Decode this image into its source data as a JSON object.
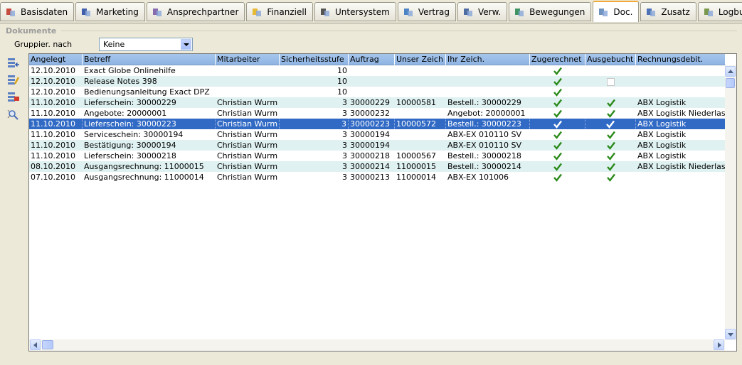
{
  "tabs": [
    {
      "label": "Basisdaten",
      "icon": "basisdaten-icon"
    },
    {
      "label": "Marketing",
      "icon": "marketing-icon"
    },
    {
      "label": "Ansprechpartner",
      "icon": "ansprechpartner-icon"
    },
    {
      "label": "Finanziell",
      "icon": "finanziell-icon"
    },
    {
      "label": "Untersystem",
      "icon": "untersystem-icon"
    },
    {
      "label": "Vertrag",
      "icon": "vertrag-icon"
    },
    {
      "label": "Verw.",
      "icon": "verw-icon"
    },
    {
      "label": "Bewegungen",
      "icon": "bewegungen-icon"
    },
    {
      "label": "Doc.",
      "icon": "doc-icon",
      "active": true
    },
    {
      "label": "Zusatz",
      "icon": "zusatz-icon"
    },
    {
      "label": "Logbuch",
      "icon": "logbuch-icon"
    }
  ],
  "group": {
    "title": "Dokumente",
    "grouping_label": "Gruppier. nach",
    "grouping_value": "Keine"
  },
  "side_icons": [
    "new-document-icon",
    "edit-document-icon",
    "delete-document-icon",
    "attach-search-icon"
  ],
  "table": {
    "columns": [
      "Angelegt",
      "Betreff",
      "Mitarbeiter",
      "Sicherheitsstufe",
      "Auftrag",
      "Unser Zeich",
      "Ihr Zeich.",
      "Zugerechnet",
      "Ausgebucht",
      "Rechnungsdebit."
    ],
    "rows": [
      {
        "angelegt": "12.10.2010",
        "betreff": "Exact Globe Onlinehilfe",
        "mitarbeiter": "",
        "stufe": "10",
        "auftrag": "",
        "unser": "",
        "ihr": "",
        "zug": "check",
        "aus": "",
        "rech": ""
      },
      {
        "angelegt": "12.10.2010",
        "betreff": "Release Notes 398",
        "mitarbeiter": "",
        "stufe": "10",
        "auftrag": "",
        "unser": "",
        "ihr": "",
        "zug": "check",
        "aus": "box",
        "rech": ""
      },
      {
        "angelegt": "12.10.2010",
        "betreff": "Bedienungsanleitung Exact DPZ",
        "mitarbeiter": "",
        "stufe": "10",
        "auftrag": "",
        "unser": "",
        "ihr": "",
        "zug": "check",
        "aus": "",
        "rech": ""
      },
      {
        "angelegt": "11.10.2010",
        "betreff": "Lieferschein: 30000229",
        "mitarbeiter": "Christian Wurm",
        "stufe": "3",
        "auftrag": "30000229",
        "unser": "10000581",
        "ihr": "Bestell.: 30000229",
        "zug": "check",
        "aus": "check",
        "rech": "ABX Logistik"
      },
      {
        "angelegt": "11.10.2010",
        "betreff": "Angebote: 20000001",
        "mitarbeiter": "Christian Wurm",
        "stufe": "3",
        "auftrag": "30000232",
        "unser": "",
        "ihr": "Angebot: 20000001",
        "zug": "check",
        "aus": "check",
        "rech": "ABX Logistik Niederlas"
      },
      {
        "angelegt": "11.10.2010",
        "betreff": "Lieferschein: 30000223",
        "mitarbeiter": "Christian Wurm",
        "stufe": "3",
        "auftrag": "30000223",
        "unser": "10000572",
        "ihr": "Bestell.: 30000223",
        "zug": "check",
        "aus": "check",
        "rech": "ABX Logistik",
        "selected": true
      },
      {
        "angelegt": "11.10.2010",
        "betreff": "Serviceschein: 30000194",
        "mitarbeiter": "Christian Wurm",
        "stufe": "3",
        "auftrag": "30000194",
        "unser": "",
        "ihr": "ABX-EX 010110 SV",
        "zug": "check",
        "aus": "check",
        "rech": "ABX Logistik"
      },
      {
        "angelegt": "11.10.2010",
        "betreff": "Bestätigung: 30000194",
        "mitarbeiter": "Christian Wurm",
        "stufe": "3",
        "auftrag": "30000194",
        "unser": "",
        "ihr": "ABX-EX 010110 SV",
        "zug": "check",
        "aus": "check",
        "rech": "ABX Logistik"
      },
      {
        "angelegt": "11.10.2010",
        "betreff": "Lieferschein: 30000218",
        "mitarbeiter": "Christian Wurm",
        "stufe": "3",
        "auftrag": "30000218",
        "unser": "10000567",
        "ihr": "Bestell.: 30000218",
        "zug": "check",
        "aus": "check",
        "rech": "ABX Logistik"
      },
      {
        "angelegt": "08.10.2010",
        "betreff": "Ausgangsrechnung: 11000015",
        "mitarbeiter": "Christian Wurm",
        "stufe": "3",
        "auftrag": "30000214",
        "unser": "11000015",
        "ihr": "Bestell.: 30000214",
        "zug": "check",
        "aus": "check",
        "rech": "ABX Logistik Niederlas"
      },
      {
        "angelegt": "07.10.2010",
        "betreff": "Ausgangsrechnung: 11000014",
        "mitarbeiter": "Christian Wurm",
        "stufe": "3",
        "auftrag": "30000213",
        "unser": "11000014",
        "ihr": "ABX-EX 101006",
        "zug": "check",
        "aus": "check",
        "rech": ""
      }
    ]
  },
  "colors": {
    "selected": "#316ac5",
    "alt_row": "#dff1f1",
    "header": "#a6c6ec",
    "active_tab": "#f2a93b",
    "check": "#2a8a1a"
  }
}
